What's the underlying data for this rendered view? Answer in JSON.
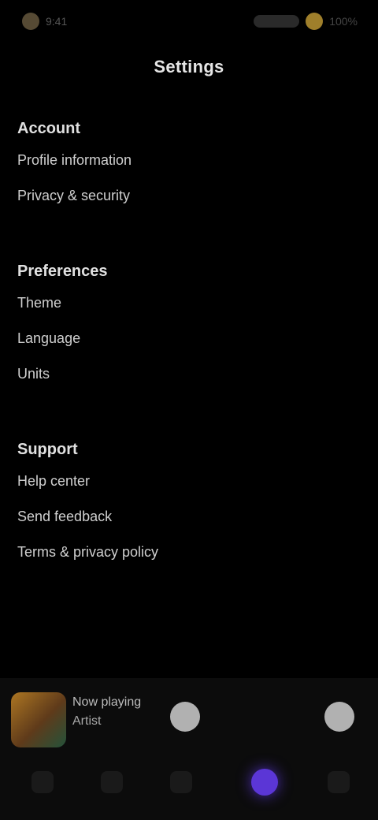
{
  "status": {
    "left_label": "9:41",
    "right_label": "100%"
  },
  "header": {
    "title": "Settings"
  },
  "sections": [
    {
      "title": "Account",
      "items": [
        "Profile information",
        "Privacy & security"
      ]
    },
    {
      "title": "Preferences",
      "items": [
        "Theme",
        "Language",
        "Units"
      ]
    },
    {
      "title": "Support",
      "items": [
        "Help center",
        "Send feedback",
        "Terms & privacy policy"
      ]
    }
  ],
  "player": {
    "title": "Now playing",
    "subtitle": "Artist"
  },
  "colors": {
    "accent": "#5b36d6",
    "status_accent": "#d4a93a"
  }
}
